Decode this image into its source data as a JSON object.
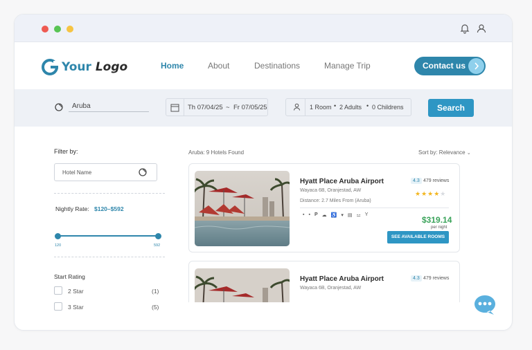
{
  "brand": {
    "logo_word1": "Your",
    "logo_word2": "Logo",
    "accent_color": "#2e86ab",
    "button_color": "#2e96c4",
    "price_color": "#3aa35a",
    "star_color": "#f3b61f"
  },
  "window": {
    "controls": [
      "close-dot",
      "minimize-dot",
      "maximize-dot"
    ],
    "icons": [
      "bell-icon",
      "user-icon"
    ]
  },
  "nav": {
    "links": [
      {
        "label": "Home",
        "active": true
      },
      {
        "label": "About",
        "active": false
      },
      {
        "label": "Destinations",
        "active": false
      },
      {
        "label": "Manage Trip",
        "active": false
      }
    ],
    "contact_label": "Contact us"
  },
  "search": {
    "destination": "Aruba",
    "checkin": "Th 07/04/25",
    "date_sep": "~",
    "checkout": "Fr 07/05/25",
    "rooms": "1 Room",
    "adults": "2 Adults",
    "children": "0 Childrens",
    "button": "Search"
  },
  "filters": {
    "title": "Filter by:",
    "hotel_name_placeholder": "Hotel Name",
    "nightly_rate_label": "Nightly Rate:",
    "nightly_rate_value": "$120–$592",
    "rate_min": "120",
    "rate_max": "592",
    "rating_title": "Start Rating",
    "rating_options": [
      {
        "label": "2 Star",
        "count": "(1)"
      },
      {
        "label": "3 Star",
        "count": "(5)"
      }
    ]
  },
  "results": {
    "summary": "Aruba: 9 Hotels Found",
    "sort_label": "Sort by: Relevance",
    "hotels": [
      {
        "name": "Hyatt Place Aruba Airport",
        "address": "Wayaca 6B, Oranjestad, AW",
        "distance": "Distance: 2.7 Miles From (Aruba)",
        "score": "4.3",
        "reviews": "479 reviews",
        "stars": "★★★★",
        "stars_value": 4,
        "price": "$319.14",
        "per_night": "per night",
        "cta": "SEE AVAILABLE ROOMS",
        "amenities": [
          "tv-icon",
          "fridge-icon",
          "parking-icon",
          "weather-icon",
          "accessible-icon",
          "coffee-icon",
          "safe-icon",
          "room-service-icon",
          "bar-icon"
        ]
      },
      {
        "name": "Hyatt Place Aruba Airport",
        "address": "Wayaca 6B, Oranjestad, AW",
        "score": "4.3",
        "reviews": "479 reviews"
      }
    ]
  },
  "chat": {
    "icon": "chat-icon"
  }
}
